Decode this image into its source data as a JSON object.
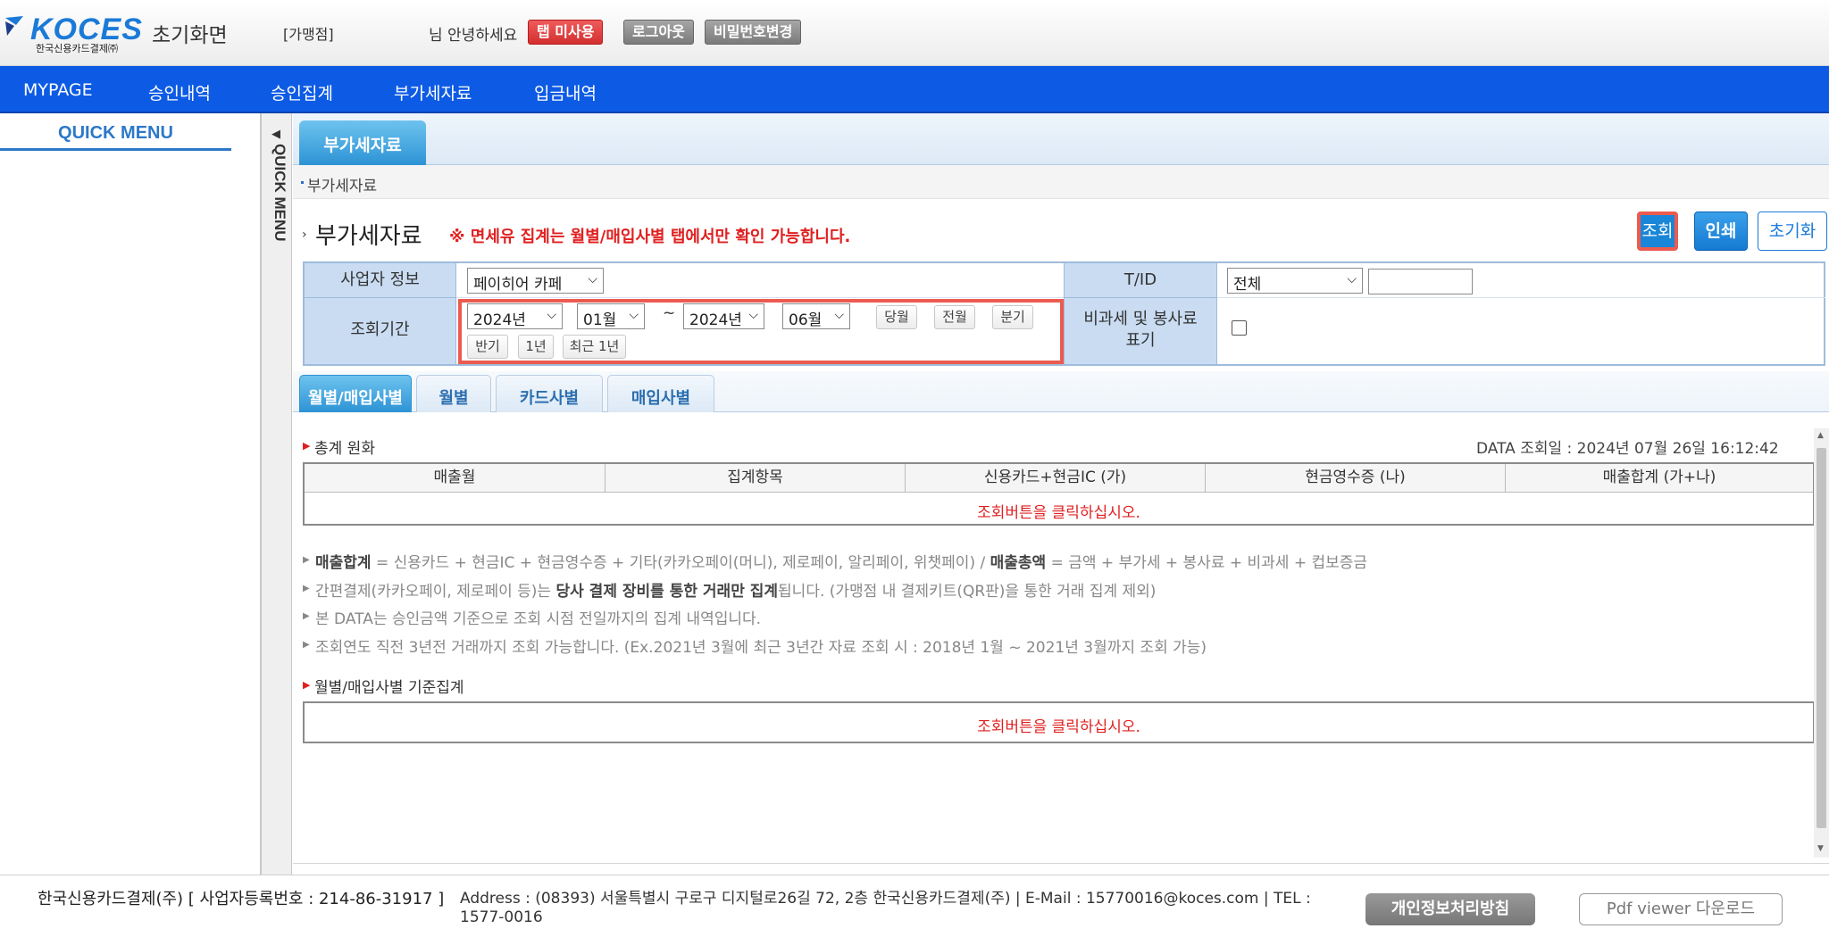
{
  "header": {
    "logo_brand": "KOCES",
    "logo_sub": "한국신용카드결제㈜",
    "home_title": "초기화면",
    "store_label": "[가맹점]",
    "greeting": "님 안녕하세요",
    "buttons": {
      "tab_unused": "탭 미사용",
      "logout": "로그아웃",
      "change_password": "비밀번호변경"
    }
  },
  "nav": {
    "items": [
      "MYPAGE",
      "승인내역",
      "승인집계",
      "부가세자료",
      "입금내역"
    ]
  },
  "sidebar": {
    "title": "QUICK MENU",
    "toggle_label": "QUICK MENU"
  },
  "main": {
    "tab": "부가세자료",
    "breadcrumb": "부가세자료",
    "title": "부가세자료",
    "notice": "※ 면세유 집계는 월별/매입사별 탭에서만 확인 가능합니다.",
    "actions": {
      "search": "조회",
      "print": "인쇄",
      "reset": "초기화"
    }
  },
  "form": {
    "biz_label": "사업자 정보",
    "biz_value": "페이히어 카페",
    "tid_label": "T/ID",
    "tid_value": "전체",
    "tid_input": "",
    "period_label": "조회기간",
    "start_year": "2024년",
    "start_month": "01월",
    "tilde": "~",
    "end_year": "2024년",
    "end_month": "06월",
    "period_buttons": [
      "당월",
      "전월",
      "분기",
      "반기",
      "1년",
      "최근 1년"
    ],
    "tax_label_line1": "비과세 및 봉사료",
    "tax_label_line2": "표기",
    "tax_checked": false
  },
  "subtabs": [
    "월별/매입사별",
    "월별",
    "카드사별",
    "매입사별"
  ],
  "summary": {
    "heading": "총계 원화",
    "data_date": "DATA 조회일 : 2024년 07월 26일 16:12:42",
    "columns": [
      "매출월",
      "집계항목",
      "신용카드+현금IC (가)",
      "현금영수증 (나)",
      "매출합계 (가+나)"
    ],
    "empty_message": "조회버튼을 클릭하십시오."
  },
  "notes": [
    {
      "b1": "매출합계",
      "t1": " = 신용카드 + 현금IC + 현금영수증 + 기타(카카오페이(머니), 제로페이, 알리페이, 위챗페이) / ",
      "b2": "매출총액",
      "t2": " = 금액 + 부가세 + 봉사료 + 비과세 + 컵보증금"
    },
    {
      "t0": "간편결제(카카오페이, 제로페이 등)는 ",
      "b1": "당사 결제 장비를 통한 거래만 집계",
      "t1": "됩니다. (가맹점 내 결제키트(QR판)을 통한 거래 집계 제외)"
    },
    {
      "t0": "본 DATA는 승인금액 기준으로 조회 시점 전일까지의 집계 내역입니다."
    },
    {
      "t0": "조회연도 직전 3년전 거래까지 조회 가능합니다. (Ex.2021년 3월에 최근 3년간 자료 조회 시 : 2018년 1월 ~ 2021년 3월까지 조회 가능)"
    }
  ],
  "detail": {
    "heading": "월별/매입사별 기준집계",
    "empty_message": "조회버튼을 클릭하십시오."
  },
  "footer": {
    "company": "한국신용카드결제(주) [ 사업자등록번호 : 214-86-31917 ]",
    "address": "Address : (08393) 서울특별시 구로구 디지털로26길 72, 2층 한국신용카드결제(주) | E-Mail : 15770016@koces.com | TEL : 1577-0016",
    "privacy": "개인정보처리방침",
    "pdf": "Pdf viewer 다운로드"
  },
  "colors": {
    "nav_blue": "#0d5be5",
    "accent_red": "#e02020",
    "highlight_border": "#ec5b4f",
    "tab_blue": "#2d93d5"
  }
}
